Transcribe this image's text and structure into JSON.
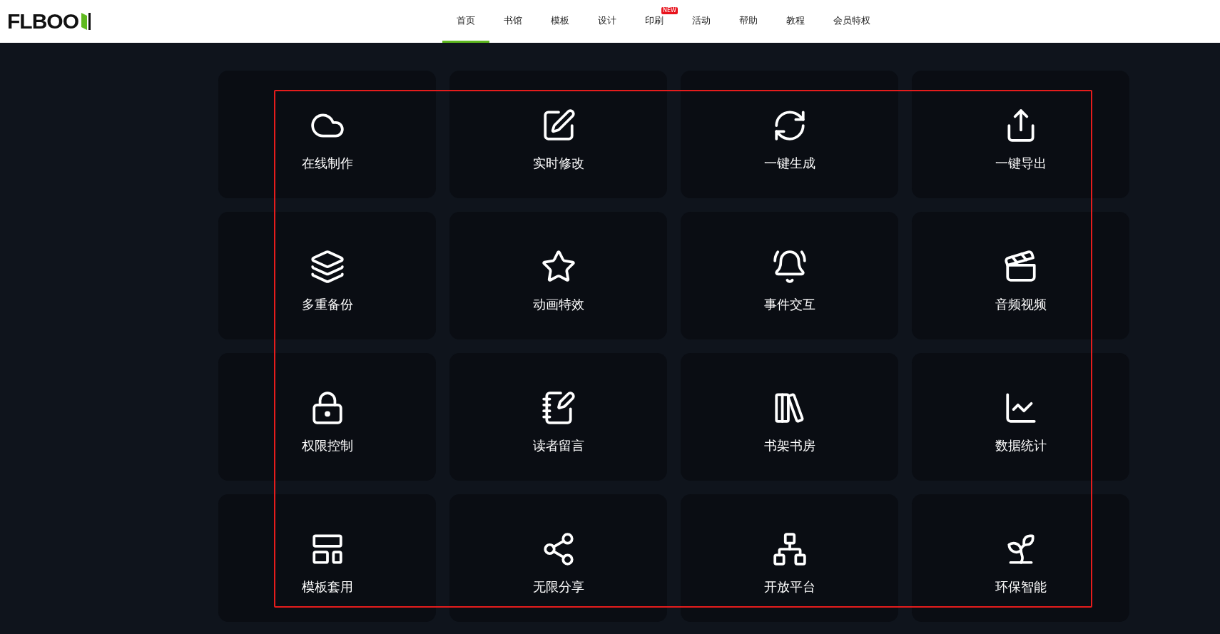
{
  "header": {
    "logo": "FLBOO",
    "nav": [
      {
        "label": "首页",
        "selected": true
      },
      {
        "label": "书馆",
        "selected": false
      },
      {
        "label": "模板",
        "selected": false
      },
      {
        "label": "设计",
        "selected": false
      },
      {
        "label": "印刷",
        "selected": false,
        "badge": "NEW"
      },
      {
        "label": "活动",
        "selected": false
      },
      {
        "label": "帮助",
        "selected": false
      },
      {
        "label": "教程",
        "selected": false
      },
      {
        "label": "会员特权",
        "selected": false
      }
    ]
  },
  "features": [
    {
      "kind": "cloud",
      "label": "在线制作"
    },
    {
      "kind": "edit",
      "label": "实时修改"
    },
    {
      "kind": "generate",
      "label": "一键生成"
    },
    {
      "kind": "export",
      "label": "一键导出"
    },
    {
      "kind": "layers",
      "label": "多重备份"
    },
    {
      "kind": "star",
      "label": "动画特效"
    },
    {
      "kind": "bell",
      "label": "事件交互"
    },
    {
      "kind": "video",
      "label": "音频视频"
    },
    {
      "kind": "lock",
      "label": "权限控制"
    },
    {
      "kind": "note",
      "label": "读者留言"
    },
    {
      "kind": "shelf",
      "label": "书架书房"
    },
    {
      "kind": "chart",
      "label": "数据统计"
    },
    {
      "kind": "template",
      "label": "模板套用"
    },
    {
      "kind": "share",
      "label": "无限分享"
    },
    {
      "kind": "platform",
      "label": "开放平台"
    },
    {
      "kind": "eco",
      "label": "环保智能"
    }
  ]
}
